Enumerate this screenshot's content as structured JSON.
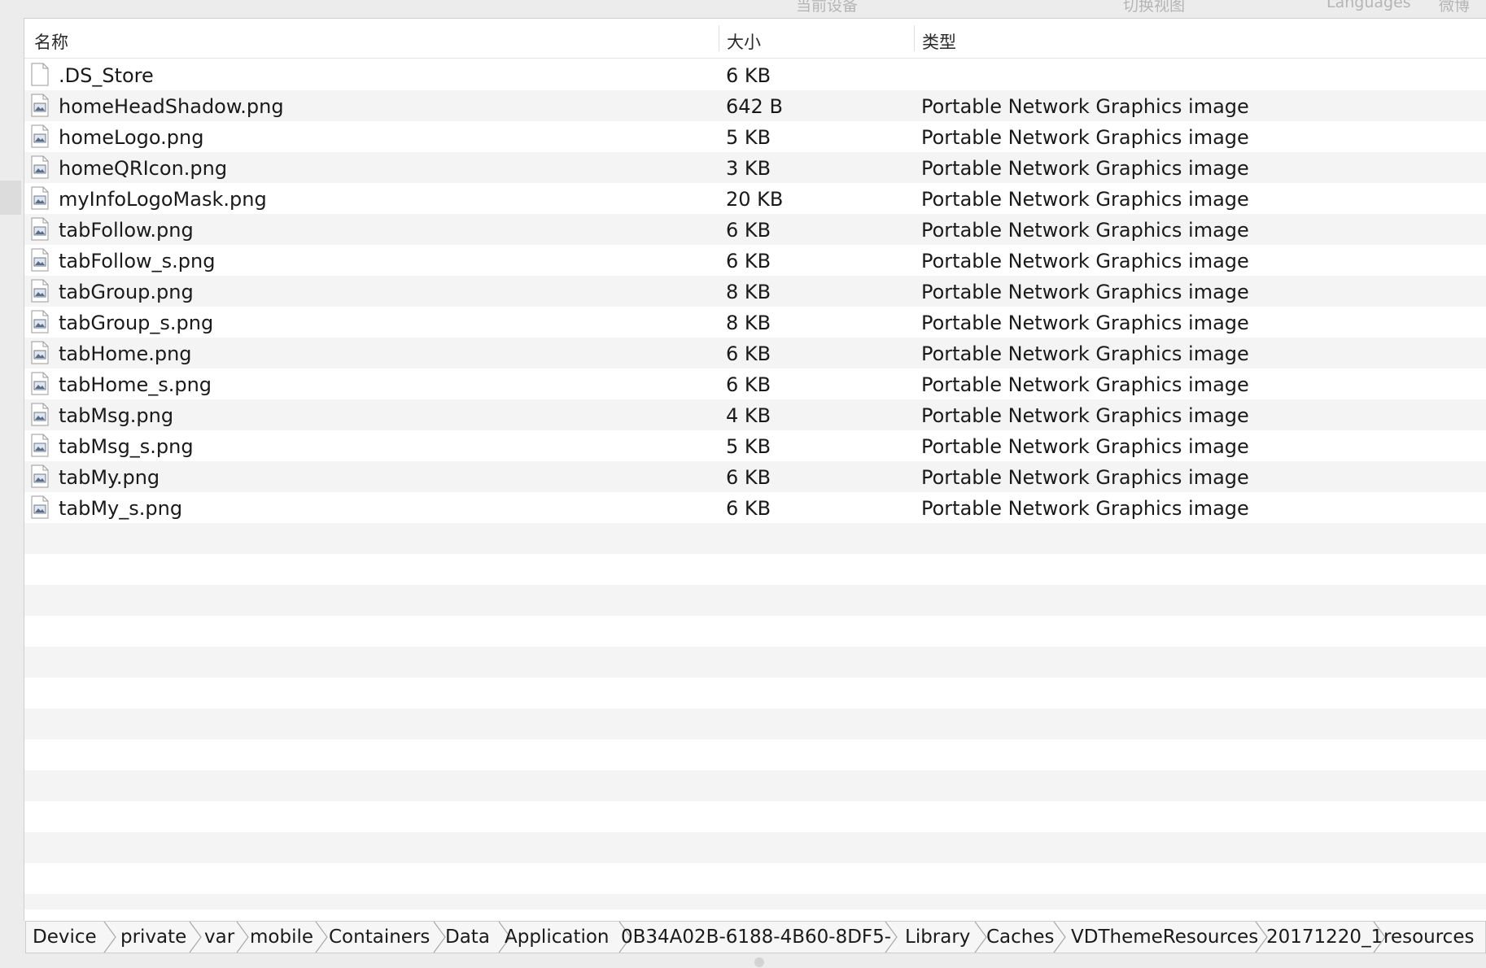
{
  "toolbar": {
    "items": [
      "当前设备",
      "切换视图",
      "Languages",
      "微博"
    ]
  },
  "table": {
    "headers": {
      "name": "名称",
      "size": "大小",
      "kind": "类型"
    },
    "rows": [
      {
        "name": ".DS_Store",
        "size": "6 KB",
        "kind": "",
        "icon": "blank-document-icon"
      },
      {
        "name": "homeHeadShadow.png",
        "size": "642 B",
        "kind": "Portable Network Graphics image",
        "icon": "png-image-icon"
      },
      {
        "name": "homeLogo.png",
        "size": "5 KB",
        "kind": "Portable Network Graphics image",
        "icon": "png-image-icon"
      },
      {
        "name": "homeQRIcon.png",
        "size": "3 KB",
        "kind": "Portable Network Graphics image",
        "icon": "png-image-icon"
      },
      {
        "name": "myInfoLogoMask.png",
        "size": "20 KB",
        "kind": "Portable Network Graphics image",
        "icon": "png-image-icon"
      },
      {
        "name": "tabFollow.png",
        "size": "6 KB",
        "kind": "Portable Network Graphics image",
        "icon": "png-image-icon"
      },
      {
        "name": "tabFollow_s.png",
        "size": "6 KB",
        "kind": "Portable Network Graphics image",
        "icon": "png-image-icon"
      },
      {
        "name": "tabGroup.png",
        "size": "8 KB",
        "kind": "Portable Network Graphics image",
        "icon": "png-image-icon"
      },
      {
        "name": "tabGroup_s.png",
        "size": "8 KB",
        "kind": "Portable Network Graphics image",
        "icon": "png-image-icon"
      },
      {
        "name": "tabHome.png",
        "size": "6 KB",
        "kind": "Portable Network Graphics image",
        "icon": "png-image-icon"
      },
      {
        "name": "tabHome_s.png",
        "size": "6 KB",
        "kind": "Portable Network Graphics image",
        "icon": "png-image-icon"
      },
      {
        "name": "tabMsg.png",
        "size": "4 KB",
        "kind": "Portable Network Graphics image",
        "icon": "png-image-icon"
      },
      {
        "name": "tabMsg_s.png",
        "size": "5 KB",
        "kind": "Portable Network Graphics image",
        "icon": "png-image-icon"
      },
      {
        "name": "tabMy.png",
        "size": "6 KB",
        "kind": "Portable Network Graphics image",
        "icon": "png-image-icon"
      },
      {
        "name": "tabMy_s.png",
        "size": "6 KB",
        "kind": "Portable Network Graphics image",
        "icon": "png-image-icon"
      }
    ]
  },
  "pathbar": {
    "crumbs": [
      "Device",
      "private",
      "var",
      "mobile",
      "Containers",
      "Data",
      "Application",
      "0B34A02B-6188-4B60-8DF5-",
      "Library",
      "Caches",
      "VDThemeResources",
      "20171220_1",
      "resources"
    ]
  },
  "colors": {
    "row_alt": "#f4f4f4",
    "row": "#ffffff",
    "text": "#1a1a1a",
    "toolbar_text": "#b5b5b5"
  }
}
